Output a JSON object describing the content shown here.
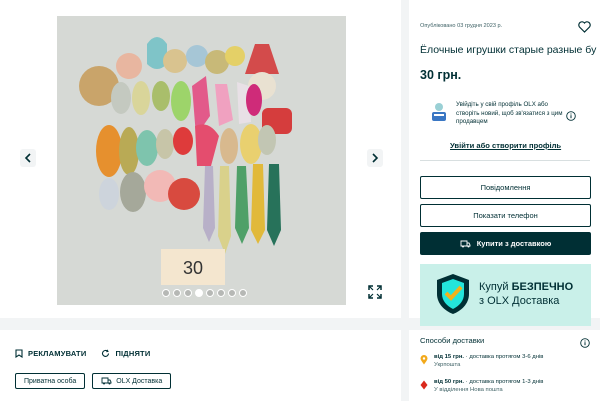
{
  "listing": {
    "posted": "Опубліковано 03 грудня 2023 р.",
    "title": "Ёлочные игрушки старые разные бу",
    "price": "30 грн.",
    "photo_label": "30"
  },
  "gallery": {
    "photo_count": 8,
    "active_index": 3
  },
  "login": {
    "text": "Увійдіть у свій профіль OLX або створіть новий, щоб зв'язатися з цим продавцем",
    "link": "Увійти або створити профіль"
  },
  "buttons": {
    "message": "Повідомлення",
    "phone": "Показати телефон",
    "buy": "Купити з доставкою"
  },
  "banner": {
    "line1_prefix": "Купуй ",
    "line1_bold": "БЕЗПЕЧНО",
    "line2": "з OLX Доставка"
  },
  "promote": {
    "advertise": "РЕКЛАМУВАТИ",
    "raise": "ПІДНЯТИ"
  },
  "tags": {
    "private": "Приватна особа",
    "delivery": "OLX Доставка"
  },
  "delivery": {
    "heading": "Способи доставки",
    "options": [
      {
        "price": "від 15 грн.",
        "terms": " · доставка протягом 3-6 днів",
        "carrier": "Укрпошта",
        "color": "#f2a91b"
      },
      {
        "price": "від 50 грн.",
        "terms": " · доставка протягом 1-3 днів",
        "carrier": "У відділення Нова пошта",
        "color": "#da291c"
      }
    ]
  },
  "colors": {
    "brand_dark": "#002f34",
    "banner_bg": "#c9f0e9",
    "shield_teal": "#23e5db"
  }
}
